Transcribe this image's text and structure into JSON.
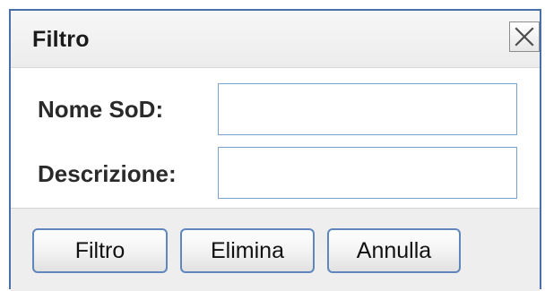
{
  "dialog": {
    "title": "Filtro",
    "close_icon": "close-icon"
  },
  "form": {
    "fields": [
      {
        "label": "Nome SoD:",
        "value": "",
        "placeholder": ""
      },
      {
        "label": "Descrizione:",
        "value": "",
        "placeholder": ""
      }
    ]
  },
  "actions": {
    "filter_label": "Filtro",
    "delete_label": "Elimina",
    "cancel_label": "Annulla"
  },
  "colors": {
    "accent_border": "#4a6fa8",
    "input_border": "#7aa2cf",
    "button_border": "#5f86bd",
    "footer_background": "#eeeeee"
  }
}
